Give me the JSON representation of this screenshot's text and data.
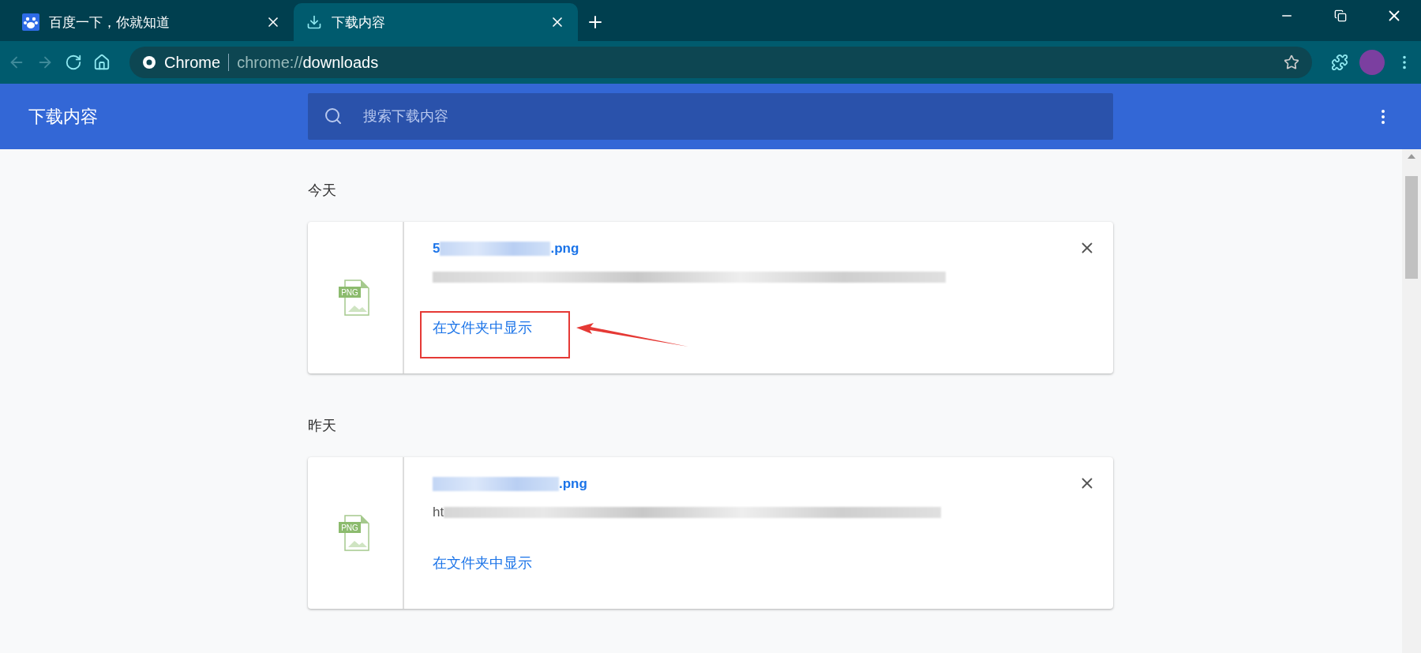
{
  "tabs": [
    {
      "title": "百度一下，你就知道",
      "kind": "paw",
      "selected": false
    },
    {
      "title": "下载内容",
      "kind": "download",
      "selected": true
    }
  ],
  "address_bar": {
    "site_label": "Chrome",
    "url_scheme": "chrome://",
    "url_path": "downloads"
  },
  "header": {
    "title": "下载内容",
    "search": {
      "placeholder": "搜索下载内容"
    }
  },
  "groups": [
    {
      "date": "今天",
      "items": [
        {
          "file_type": "PNG",
          "name_head": "5",
          "name_tail": ".png",
          "action": "在文件夹中显示",
          "annotated": true
        }
      ]
    },
    {
      "date": "昨天",
      "items": [
        {
          "file_type": "PNG",
          "name_tail": ".png",
          "url_head": "ht",
          "action": "在文件夹中显示",
          "annotated": false
        }
      ]
    }
  ]
}
